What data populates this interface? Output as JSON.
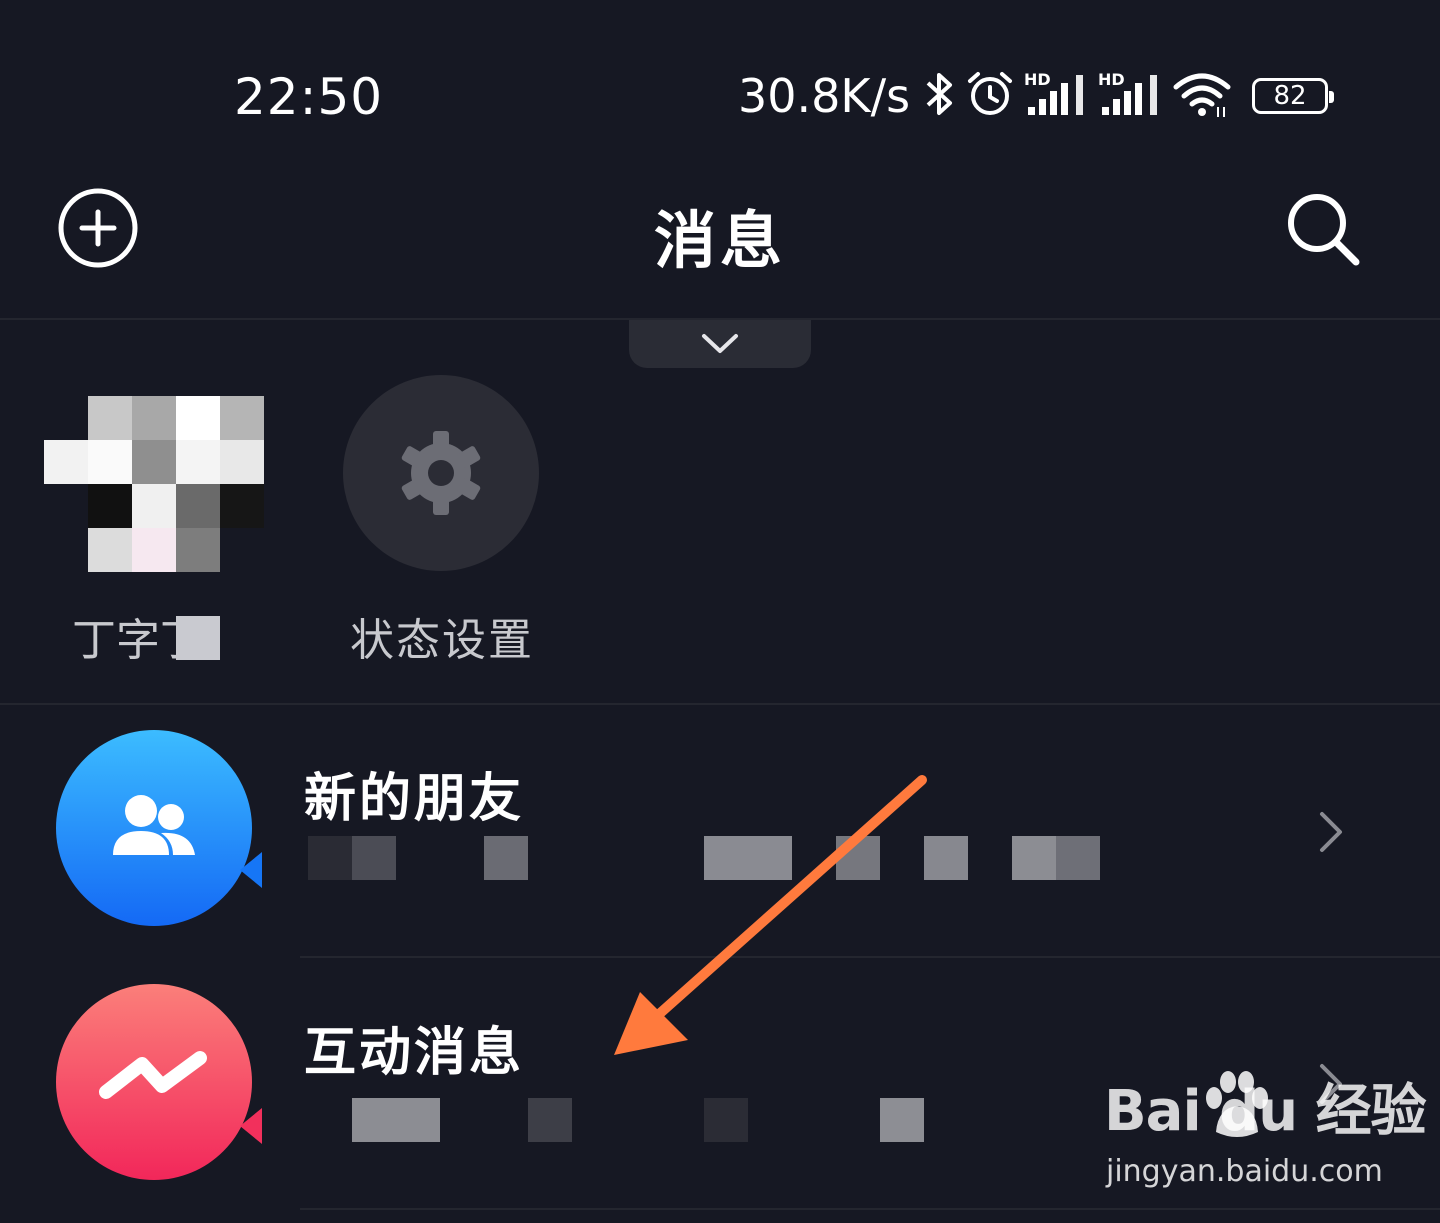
{
  "status_bar": {
    "time": "22:50",
    "net_speed": "30.8K/s",
    "icons": [
      "bluetooth-icon",
      "alarm-icon",
      "signal-hd-icon",
      "signal-hd-icon",
      "wifi-icon"
    ],
    "hd_label": "HD",
    "battery": "82"
  },
  "header": {
    "title": "消息",
    "left_icon": "add-circle-icon",
    "right_icon": "search-icon"
  },
  "status_row": {
    "items": [
      {
        "label": "丁字丁",
        "type": "avatar"
      },
      {
        "label": "状态设置",
        "icon": "gear-icon"
      }
    ]
  },
  "messages": [
    {
      "title": "新的朋友",
      "icon": "friends-icon",
      "accent": "#1e90ff"
    },
    {
      "title": "互动消息",
      "icon": "interaction-icon",
      "accent": "#f23d5c"
    }
  ],
  "annotation": {
    "arrow_color": "#ff7a3d"
  },
  "watermark": {
    "logo": "Bai du 经验",
    "url": "jingyan.baidu.com"
  }
}
